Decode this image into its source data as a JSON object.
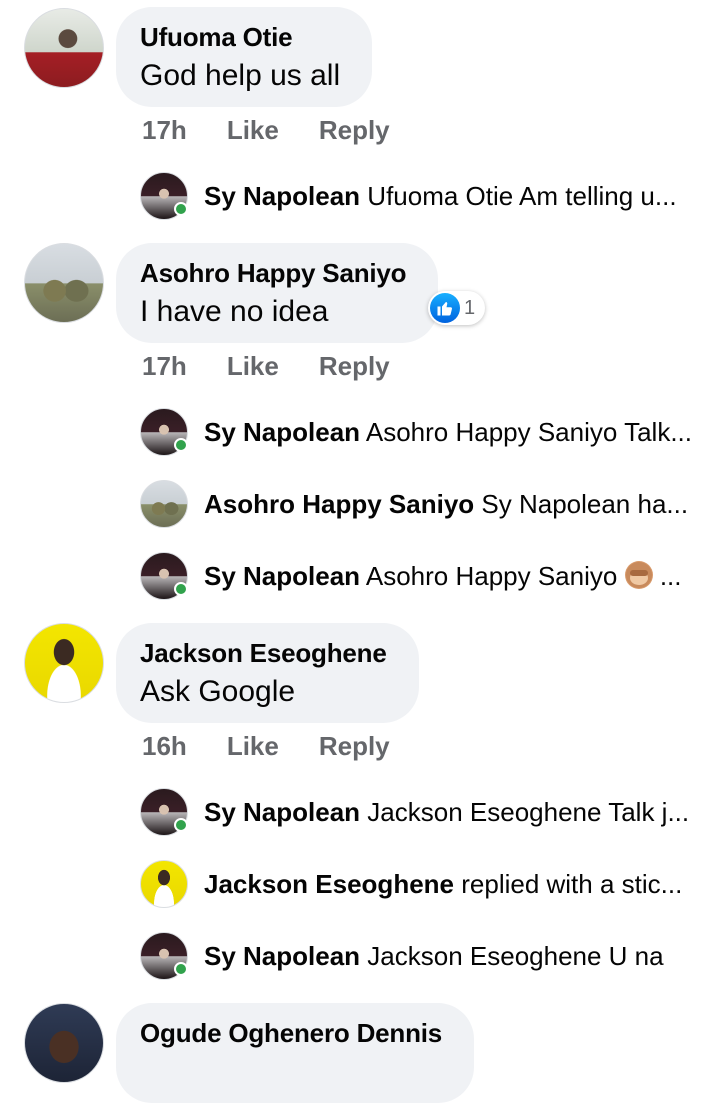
{
  "comments": [
    {
      "name": "Ufuoma Otie",
      "text": "God help us all",
      "time": "17h",
      "like_label": "Like",
      "reply_label": "Reply",
      "replies": [
        {
          "name": "Sy Napolean",
          "text": "Ufuoma Otie Am telling u..."
        }
      ]
    },
    {
      "name": "Asohro Happy Saniyo",
      "text": "I have no idea",
      "reaction_count": "1",
      "time": "17h",
      "like_label": "Like",
      "reply_label": "Reply",
      "replies": [
        {
          "name": "Sy Napolean",
          "text": "Asohro Happy Saniyo Talk..."
        },
        {
          "name": "Asohro Happy Saniyo",
          "text": "Sy Napolean ha..."
        },
        {
          "name": "Sy Napolean",
          "text": "Asohro Happy Saniyo",
          "suffix": "..."
        }
      ]
    },
    {
      "name": "Jackson Eseoghene",
      "text": "Ask Google",
      "time": "16h",
      "like_label": "Like",
      "reply_label": "Reply",
      "replies": [
        {
          "name": "Sy Napolean",
          "text": "Jackson Eseoghene Talk j..."
        },
        {
          "name": "Jackson Eseoghene",
          "text": "replied with a stic..."
        },
        {
          "name": "Sy Napolean",
          "text": "Jackson Eseoghene U na"
        }
      ]
    },
    {
      "name": "Ogude Oghenero Dennis"
    }
  ],
  "colors": {
    "bubble_bg": "#f0f2f5",
    "meta_text": "#65676b",
    "online_green": "#31a24c",
    "like_blue": "#1877f2"
  },
  "icons": {
    "like_reaction": "like-thumb-icon",
    "emoji": "see-no-evil-monkey-emoji"
  }
}
